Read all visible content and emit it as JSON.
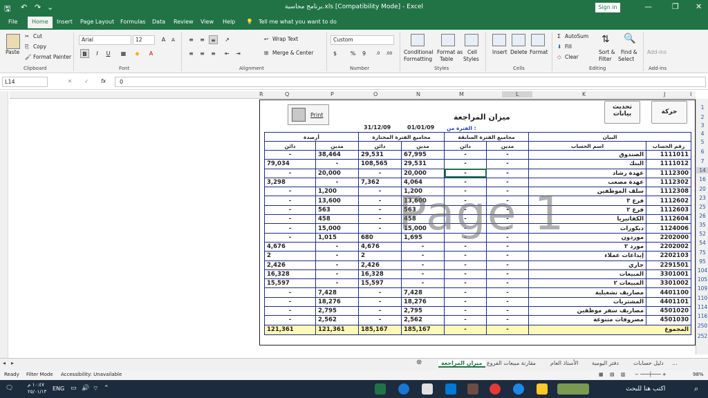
{
  "titlebar": {
    "title": "برنامج محاسبة.xls  [Compatibility Mode]  -  Excel",
    "signin": "Sign in",
    "min": "—",
    "restore": "❐",
    "close": "✕",
    "autosave": "🖫",
    "undo": "↶",
    "redo": "↷",
    "customize": "⌄"
  },
  "tabs": [
    "File",
    "Home",
    "Insert",
    "Page Layout",
    "Formulas",
    "Data",
    "Review",
    "View",
    "Help"
  ],
  "tellme": "Tell me what you want to do",
  "ribbon": {
    "clipboard": {
      "paste": "Paste",
      "cut": "Cut",
      "copy": "Copy",
      "painter": "Format Painter",
      "label": "Clipboard"
    },
    "font": {
      "name": "Arial",
      "size": "12",
      "label": "Font",
      "bold": "B",
      "italic": "I",
      "underline": "U",
      "grow": "A",
      "shrink": "A"
    },
    "alignment": {
      "wrap": "Wrap Text",
      "merge": "Merge & Center",
      "label": "Alignment"
    },
    "number": {
      "format": "Custom",
      "label": "Number",
      "currency": "$",
      "percent": "%",
      "comma": "9"
    },
    "styles": {
      "cond": "Conditional",
      "cond2": "Formatting",
      "fmt": "Format as",
      "fmt2": "Table",
      "cell": "Cell",
      "cell2": "Styles",
      "label": "Styles"
    },
    "cells": {
      "insert": "Insert",
      "delete": "Delete",
      "format": "Format",
      "label": "Cells"
    },
    "editing": {
      "autosum": "AutoSum",
      "fill": "Fill",
      "clear": "Clear",
      "sort": "Sort &",
      "sort2": "Filter",
      "find": "Find &",
      "find2": "Select",
      "label": "Editing"
    },
    "addins": {
      "btn": "Add-ins",
      "label": "Add-ins"
    }
  },
  "formula": {
    "namebox": "L14",
    "value": "0",
    "fx": "fx"
  },
  "columns": [
    "R",
    "Q",
    "P",
    "O",
    "N",
    "M",
    "L",
    "K",
    "J",
    "I"
  ],
  "rows": [
    "1",
    "2",
    "3",
    "4",
    "5",
    "6",
    "7",
    "14",
    "16",
    "20",
    "23",
    "25",
    "26",
    "35",
    "52",
    "54",
    "75",
    "95",
    "104",
    "105",
    "109",
    "110",
    "114",
    "116",
    "250",
    "252"
  ],
  "report": {
    "title": "ميزان المراجعة",
    "print": "Print",
    "btn_update": "تحديث",
    "btn_update2": "بيانات",
    "btn_move": "حركة",
    "period_label": "الفترة من :",
    "date_from": "01/01/09",
    "date_to": "31/12/09",
    "group_headers": [
      "البيان",
      "مجاميع الفترة السابقة",
      "مجاميع الفترة المختارة",
      "أرصدة"
    ],
    "sub_headers": [
      "رقم الحساب",
      "اسم الحساب",
      "مدين",
      "دائن",
      "مدين",
      "دائن",
      "مدين",
      "دائن"
    ],
    "rows": [
      [
        "1111011",
        "الصندوق",
        "-",
        "-",
        "67,995",
        "29,531",
        "38,464",
        "-"
      ],
      [
        "1111012",
        "البنك",
        "-",
        "-",
        "29,531",
        "108,565",
        "-",
        "79,034"
      ],
      [
        "1112300",
        "عهدة رشاد",
        "-",
        "-",
        "20,000",
        "-",
        "20,000",
        "-"
      ],
      [
        "1112302",
        "عهدة مصعب",
        "-",
        "-",
        "4,064",
        "7,362",
        "-",
        "3,298"
      ],
      [
        "1112308",
        "سلف الموظفين",
        "-",
        "-",
        "1,200",
        "-",
        "1,200",
        "-"
      ],
      [
        "1112602",
        "فرع ٣",
        "-",
        "-",
        "13,600",
        "-",
        "13,600",
        "-"
      ],
      [
        "1112603",
        "فرع ٢",
        "-",
        "-",
        "563",
        "-",
        "563",
        "-"
      ],
      [
        "1112604",
        "الكفاتيريا",
        "-",
        "-",
        "458",
        "-",
        "458",
        "-"
      ],
      [
        "1124006",
        "ديكورات",
        "-",
        "-",
        "15,000",
        "-",
        "15,000",
        "-"
      ],
      [
        "2202000",
        "موردون",
        "-",
        "-",
        "1,695",
        "680",
        "1,015",
        "-"
      ],
      [
        "2202002",
        "مورد ٢",
        "-",
        "-",
        "-",
        "4,676",
        "-",
        "4,676"
      ],
      [
        "2202103",
        "إيداعات عملاء",
        "-",
        "-",
        "-",
        "2",
        "-",
        "2"
      ],
      [
        "2291501",
        "جاري",
        "-",
        "-",
        "-",
        "2,426",
        "-",
        "2,426"
      ],
      [
        "3301001",
        "المبيعات",
        "-",
        "-",
        "-",
        "16,328",
        "-",
        "16,328"
      ],
      [
        "3301002",
        "المبيعات ٢",
        "-",
        "-",
        "-",
        "15,597",
        "-",
        "15,597"
      ],
      [
        "4401100",
        "مصاريف تشغيلية",
        "-",
        "-",
        "7,428",
        "-",
        "7,428",
        "-"
      ],
      [
        "4401101",
        "المشتريات",
        "-",
        "-",
        "18,276",
        "-",
        "18,276",
        "-"
      ],
      [
        "4501020",
        "مصاريف سفر موظفين",
        "-",
        "-",
        "2,795",
        "-",
        "2,795",
        "-"
      ],
      [
        "4501030",
        "مصروفات متنوعة",
        "-",
        "-",
        "2,562",
        "-",
        "2,562",
        "-"
      ]
    ],
    "total": [
      "المجموع",
      "-",
      "-",
      "185,167",
      "185,167",
      "121,361",
      "121,361"
    ],
    "watermark": "Page 1"
  },
  "sheets": [
    "...",
    "دليل حسابات",
    "دفتر اليومية",
    "الأستاذ العام",
    "مقارنة مبيعات الفروع",
    "ميزان المراجعة"
  ],
  "status": {
    "ready": "Ready",
    "filter": "Filter Mode",
    "access": "Accessibility: Unavailable",
    "zoom": "98%"
  },
  "taskbar": {
    "search": "اكتب هنا للبحث",
    "lang": "ENG",
    "time": "١٠:٤٧ م",
    "date": "٢٥/٠١/١٣"
  },
  "colors": {
    "accent": "#217346",
    "total": "#fef9b5",
    "border": "#1a2a8a"
  }
}
